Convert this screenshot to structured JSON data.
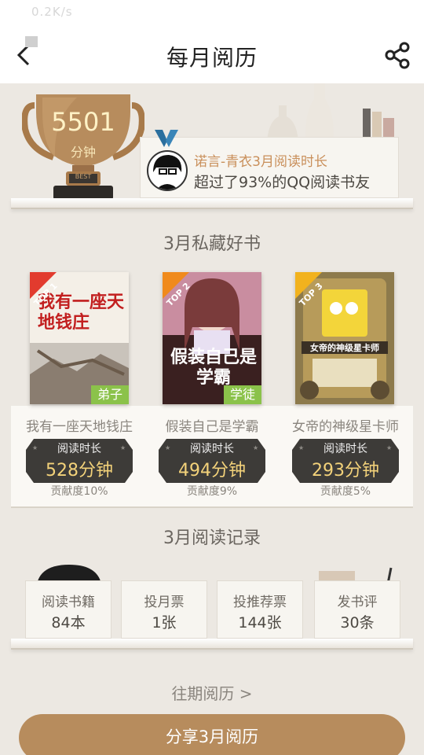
{
  "status_bar": {
    "speed": "0.2K/s"
  },
  "nav": {
    "title": "每月阅历"
  },
  "summary": {
    "minutes": "5501",
    "unit": "分钟",
    "badge": "BEST",
    "user_line": "诺言-青衣3月阅读时长",
    "compare_line": "超过了93%的QQ阅读书友"
  },
  "favorites": {
    "title": "3月私藏好书",
    "reading_label": "阅读时长",
    "books": [
      {
        "rank": "TOP 1",
        "cover_text": "我有一座天地钱庄",
        "tag": "弟子",
        "name": "我有一座天地钱庄",
        "minutes": "528分钟",
        "contribution": "贡献度10%"
      },
      {
        "rank": "TOP 2",
        "cover_text": "假装自己是学霸",
        "tag": "学徒",
        "name": "假装自己是学霸",
        "minutes": "494分钟",
        "contribution": "贡献度9%"
      },
      {
        "rank": "TOP 3",
        "cover_text": "女帝的神级星卡师",
        "tag": "",
        "name": "女帝的神级星卡师",
        "minutes": "293分钟",
        "contribution": "贡献度5%"
      }
    ]
  },
  "records": {
    "title": "3月阅读记录",
    "items": [
      {
        "label": "阅读书籍",
        "value": "84本"
      },
      {
        "label": "投月票",
        "value": "1张"
      },
      {
        "label": "投推荐票",
        "value": "144张"
      },
      {
        "label": "发书评",
        "value": "30条"
      }
    ]
  },
  "history_link": "往期阅历 >",
  "share_button": "分享3月阅历",
  "colors": {
    "accent": "#b78c5d",
    "tag_green": "#8bc24a",
    "gold": "#f3d27a"
  }
}
